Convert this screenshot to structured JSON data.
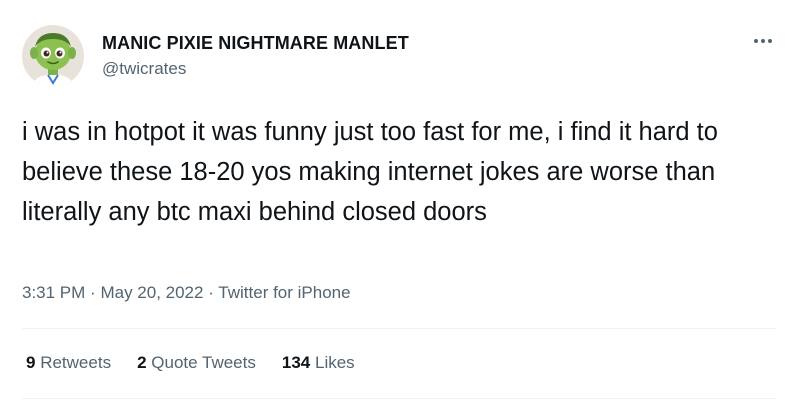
{
  "author": {
    "display_name": "MANIC PIXIE NIGHTMARE MANLET",
    "handle": "@twicrates",
    "avatar_icon": "green-cartoon-character-avatar"
  },
  "more_icon": "ellipsis-icon",
  "tweet": {
    "text": "i was in hotpot it was funny just too fast for me, i find it hard to believe these 18-20 yos making internet jokes are worse than literally any btc maxi behind closed doors"
  },
  "meta": {
    "time": "3:31 PM",
    "separator": "·",
    "date": "May 20, 2022",
    "source": "Twitter for iPhone"
  },
  "stats": {
    "retweets": {
      "count": "9",
      "label": "Retweets"
    },
    "quote_tweets": {
      "count": "2",
      "label": "Quote Tweets"
    },
    "likes": {
      "count": "134",
      "label": "Likes"
    }
  },
  "colors": {
    "primary_text": "#0f1419",
    "secondary_text": "#536471",
    "divider": "#eff3f4"
  }
}
